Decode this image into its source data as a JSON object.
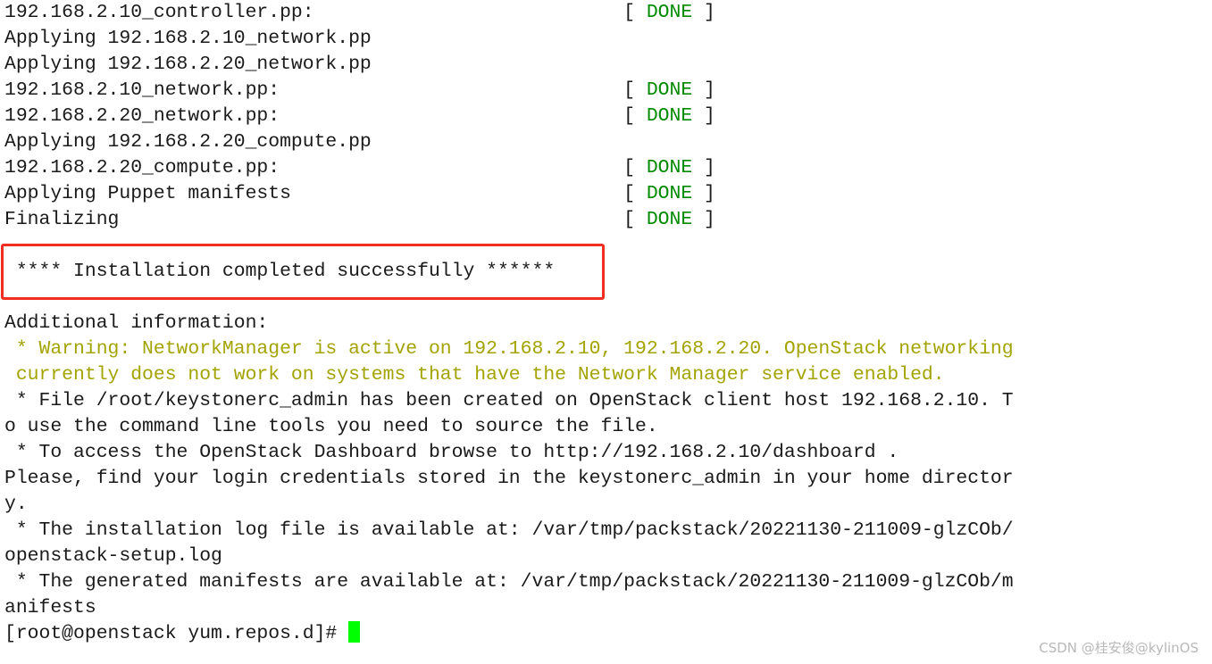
{
  "colors": {
    "done": "#008a00",
    "warning": "#a3a300",
    "highlight_box": "#f22d22",
    "cursor": "#00ff00"
  },
  "status_lines": [
    {
      "label": "192.168.2.10_controller.pp:",
      "status": "DONE"
    },
    {
      "label": "Applying 192.168.2.10_network.pp",
      "status": null
    },
    {
      "label": "Applying 192.168.2.20_network.pp",
      "status": null
    },
    {
      "label": "192.168.2.10_network.pp:",
      "status": "DONE"
    },
    {
      "label": "192.168.2.20_network.pp:",
      "status": "DONE"
    },
    {
      "label": "Applying 192.168.2.20_compute.pp",
      "status": null
    },
    {
      "label": "192.168.2.20_compute.pp:",
      "status": "DONE"
    },
    {
      "label": "Applying Puppet manifests",
      "status": "DONE"
    },
    {
      "label": "Finalizing",
      "status": "DONE"
    }
  ],
  "success_message": " **** Installation completed successfully ******",
  "info_lines": [
    {
      "text": "Additional information:",
      "type": "normal"
    },
    {
      "text": " * Warning: NetworkManager is active on 192.168.2.10, 192.168.2.20. OpenStack networking",
      "type": "warning"
    },
    {
      "text": " currently does not work on systems that have the Network Manager service enabled.",
      "type": "warning"
    },
    {
      "text": " * File /root/keystonerc_admin has been created on OpenStack client host 192.168.2.10. T",
      "type": "normal"
    },
    {
      "text": "o use the command line tools you need to source the file.",
      "type": "normal"
    },
    {
      "text": " * To access the OpenStack Dashboard browse to http://192.168.2.10/dashboard .",
      "type": "normal"
    },
    {
      "text": "Please, find your login credentials stored in the keystonerc_admin in your home director",
      "type": "normal"
    },
    {
      "text": "y.",
      "type": "normal"
    },
    {
      "text": " * The installation log file is available at: /var/tmp/packstack/20221130-211009-glzCOb/",
      "type": "normal"
    },
    {
      "text": "openstack-setup.log",
      "type": "normal"
    },
    {
      "text": " * The generated manifests are available at: /var/tmp/packstack/20221130-211009-glzCOb/m",
      "type": "normal"
    },
    {
      "text": "anifests",
      "type": "normal"
    }
  ],
  "prompt": "[root@openstack yum.repos.d]#",
  "watermark": "CSDN @桂安俊@kylinOS"
}
